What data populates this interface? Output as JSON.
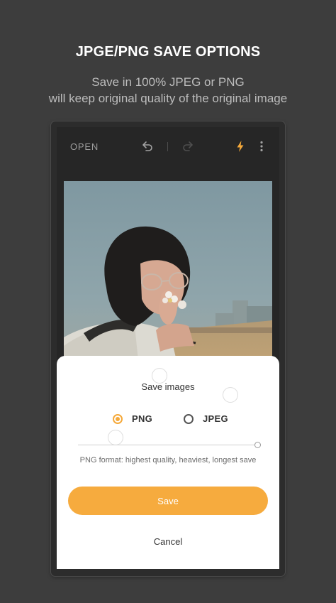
{
  "promo": {
    "title": "JPGE/PNG SAVE OPTIONS",
    "subtitle_line1": "Save in 100% JPEG or PNG",
    "subtitle_line2": "will keep original quality of the original image"
  },
  "toolbar": {
    "open_label": "OPEN",
    "icons": [
      "undo-icon",
      "redo-icon",
      "flash-icon",
      "more-vert-icon"
    ],
    "accent": "#f5a93a"
  },
  "dialog": {
    "title": "Save images",
    "options": [
      {
        "label": "PNG",
        "selected": true
      },
      {
        "label": "JPEG",
        "selected": false
      }
    ],
    "quality_level": 1.0,
    "format_note": "PNG format: highest quality, heaviest, longest save",
    "save_label": "Save",
    "cancel_label": "Cancel"
  },
  "colors": {
    "background": "#3d3d3d",
    "accent": "#f6ab3e",
    "sheet": "#ffffff"
  }
}
